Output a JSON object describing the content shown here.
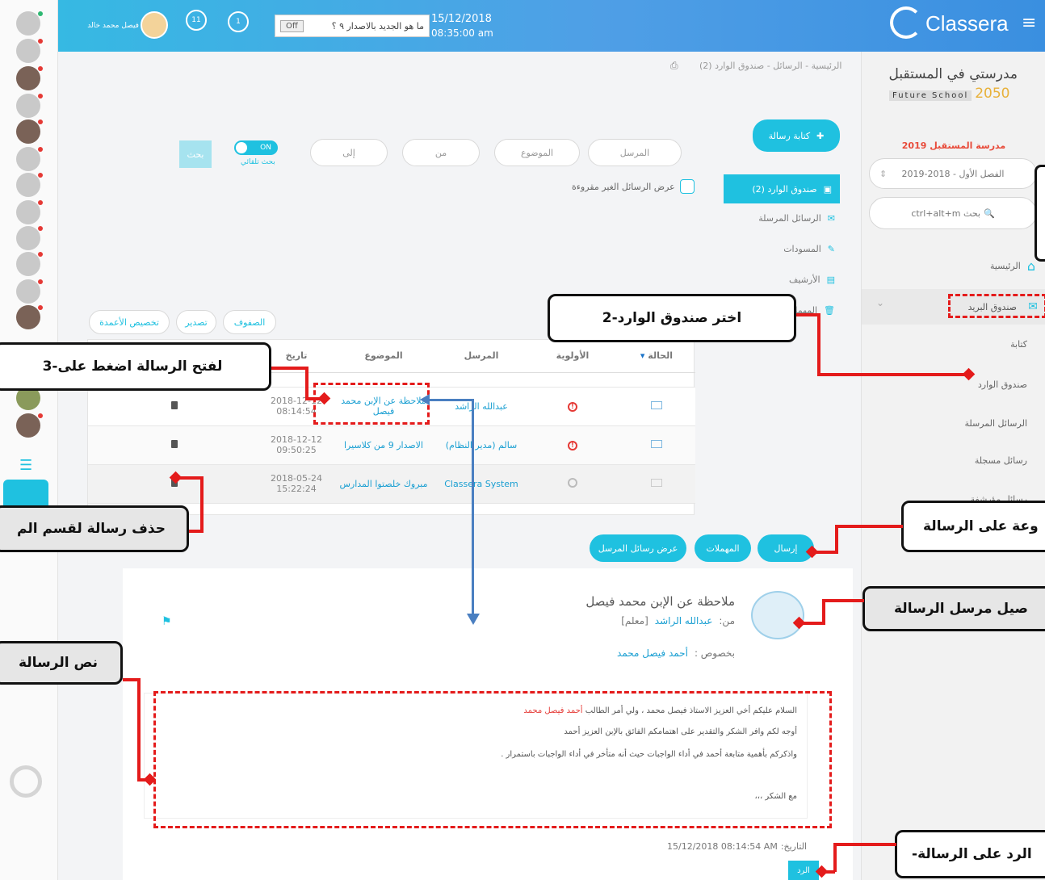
{
  "topbar": {
    "brand": "Classera",
    "user_name": "فيصل محمد خالد",
    "notif_count": "11",
    "msg_count": "1",
    "whats_new": "ما هو الجديد بالاصدار ٩ ؟",
    "toggle_label": "Off",
    "date": "15/12/2018",
    "time": "08:35:00 am"
  },
  "sidebar": {
    "school_title": "مدرستي في المستقبل",
    "school_sub": "Future School",
    "school_year": "2050",
    "school_name": "مدرسة المستقبل 2019",
    "semester": "الفصل الأول - 2018-2019",
    "search": "بحث ctrl+alt+m",
    "home": "الرئيسية",
    "mailbox": "صندوق البريد",
    "items": [
      "كتابة",
      "صندوق الوارد",
      "الرسائل المرسلة",
      "رسائل مسجلة",
      "رسائل مؤرشفة"
    ]
  },
  "breadcrumb": "الرئيسية - الرسائل - صندوق الوارد (2)",
  "compose": "كتابة رسالة",
  "filters": {
    "sender": "المرسل",
    "subject": "الموضوع",
    "from": "من",
    "to": "إلى",
    "toggle": "ON",
    "auto_search": "بحث تلقائي",
    "search_btn": "بحث",
    "unread": "عرض الرسائل الغير مقروءة"
  },
  "folders": {
    "inbox": "صندوق الوارد (2)",
    "sent": "الرسائل المرسلة",
    "drafts": "المسودات",
    "archive": "الأرشيف",
    "trash": "المهملات"
  },
  "table_tools": {
    "rows": "الصفوف",
    "export": "تصدير",
    "customize": "تخصيص الأعمدة"
  },
  "table": {
    "headers": [
      "الحالة",
      "الأولوية",
      "المرسل",
      "الموضوع",
      "تاريخ"
    ],
    "rows": [
      {
        "sender": "عبدالله الراشد",
        "subject": "ملاحظة عن الإبن محمد فيصل",
        "date": "2018-12-12",
        "time": "08:14:54",
        "priority": "high"
      },
      {
        "sender": "سالم (مدير النظام)",
        "subject": "الاصدار 9 من كلاسيرا",
        "date": "2018-12-12",
        "time": "09:50:25",
        "priority": "high"
      },
      {
        "sender": "Classera System",
        "subject": "مبروك خلصتوا المدارس",
        "date": "2018-05-24",
        "time": "15:22:24",
        "priority": "normal"
      }
    ]
  },
  "action_tabs": {
    "show_sender": "عرض رسائل المرسل",
    "trash": "المهملات",
    "send": "إرسال"
  },
  "message": {
    "title": "ملاحظة عن الإبن محمد فيصل",
    "from_label": "من:",
    "from_name": "عبدالله الراشد",
    "role": "[معلم]",
    "regarding_label": "بخصوص :",
    "regarding_name": "أحمد فيصل محمد",
    "line1": "السلام عليكم أخي العزيز الاستاذ فيصل محمد ، ولي أمر الطالب",
    "line1_name": "أحمد فيصل محمد",
    "line2": "أوجه لكم وافر الشكر والتقدير على اهتمامكم الفائق بالإبن العزيز أحمد",
    "line3": "واذكركم بأهمية متابعة أحمد في أداء الواجبات حيث أنه متأخر في أداء الواجبات باستمرار .",
    "closing": "مع الشكر ،،،",
    "date_label": "التاريخ:",
    "date_value": "15/12/2018 08:14:54 AM",
    "reply": "الرد"
  },
  "callouts": {
    "c2": "2-اختر صندوق الوارد",
    "c3": "3-لفتح الرسالة اضغط على",
    "delete": "حذف رسالة لقسم الم",
    "group": "وعة على الرسالة",
    "sender": "صيل مرسل الرسالة",
    "body": "نص الرسالة",
    "reply": "-الرد على الرسالة"
  },
  "colors": {
    "accent": "#1fc1e0",
    "annotation": "#e41b1b",
    "topbar": "#4aa3e4"
  }
}
